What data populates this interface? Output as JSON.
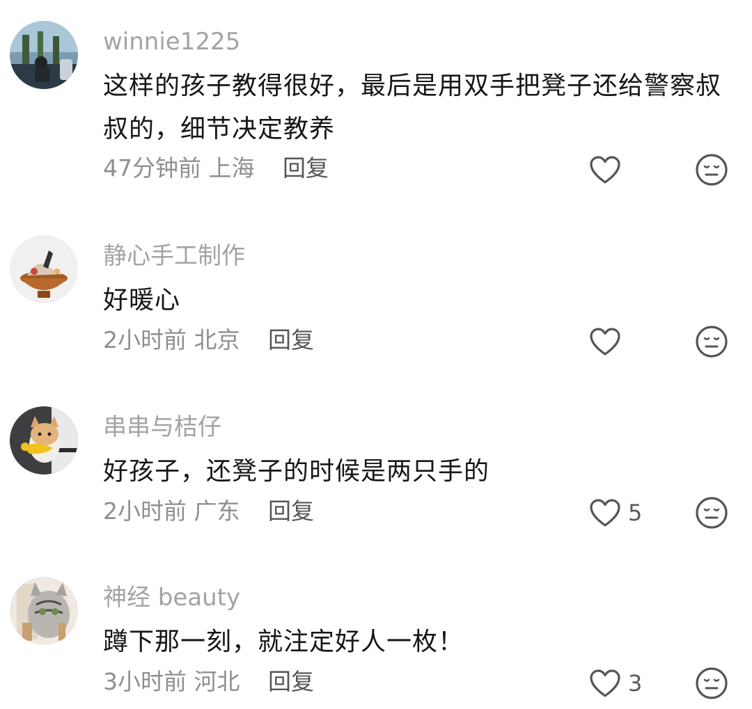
{
  "comments": [
    {
      "username": "winnie1225",
      "text": "这样的孩子教得很好，最后是用双手把凳子还给警察叔叔的，细节决定教养",
      "time": "47分钟前",
      "location": "上海",
      "reply_label": "回复",
      "like_count": ""
    },
    {
      "username": "静心手工制作",
      "text": "好暖心",
      "time": "2小时前",
      "location": "北京",
      "reply_label": "回复",
      "like_count": ""
    },
    {
      "username": "串串与桔仔",
      "text": "好孩子，还凳子的时候是两只手的",
      "time": "2小时前",
      "location": "广东",
      "reply_label": "回复",
      "like_count": "5"
    },
    {
      "username": "神经 beauty",
      "text": "蹲下那一刻，就注定好人一枚！",
      "time": "3小时前",
      "location": "河北",
      "reply_label": "回复",
      "like_count": "3"
    }
  ],
  "icons": {
    "like": "heart-outline-icon",
    "dislike": "neutral-face-icon"
  },
  "colors": {
    "username": "#a3a3a3",
    "body_text": "#161616",
    "meta": "#8f8f8f",
    "reply": "#555555",
    "icon_stroke": "#555555"
  }
}
